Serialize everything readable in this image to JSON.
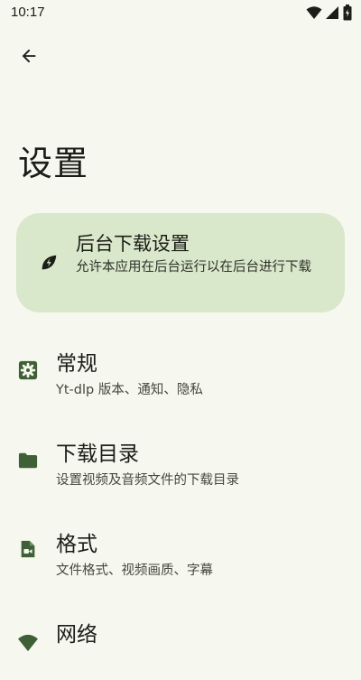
{
  "status_bar": {
    "time": "10:17"
  },
  "page_title": "设置",
  "highlight_card": {
    "title": "后台下载设置",
    "subtitle": "允许本应用在后台运行以在后台进行下载"
  },
  "settings_items": [
    {
      "title": "常规",
      "subtitle": "Yt-dlp 版本、通知、隐私"
    },
    {
      "title": "下载目录",
      "subtitle": "设置视频及音频文件的下载目录"
    },
    {
      "title": "格式",
      "subtitle": "文件格式、视频画质、字幕"
    },
    {
      "title": "网络",
      "subtitle": ""
    }
  ],
  "colors": {
    "background": "#f6f7ee",
    "card": "#d9e7cb",
    "icon": "#3f5f36"
  }
}
